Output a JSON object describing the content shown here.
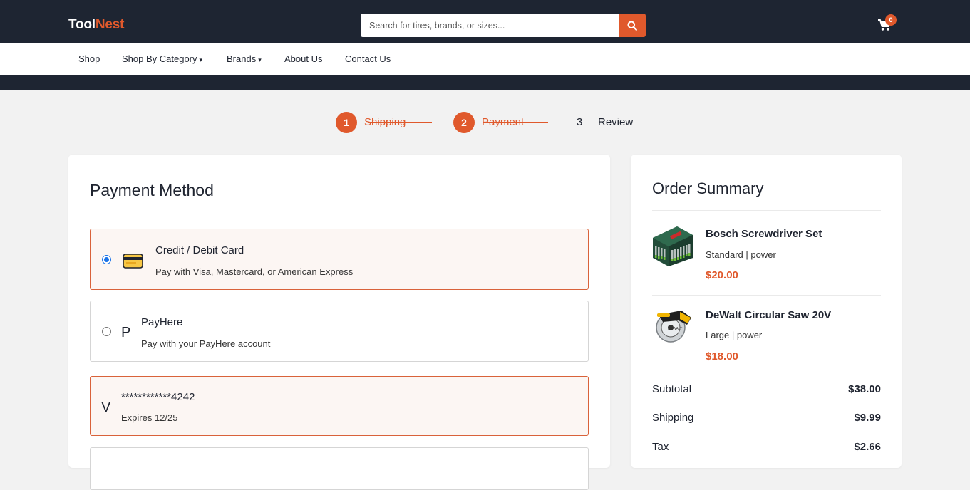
{
  "header": {
    "logo_part1": "Tool",
    "logo_part2": "Nest",
    "search_placeholder": "Search for tires, brands, or sizes...",
    "cart_count": "0",
    "accent_color": "#e0592c",
    "dark_color": "#1e2532"
  },
  "nav": {
    "items": [
      {
        "label": "Shop"
      },
      {
        "label": "Shop By Category",
        "caret": "▾"
      },
      {
        "label": "Brands",
        "caret": "▾"
      },
      {
        "label": "About Us"
      },
      {
        "label": "Contact Us"
      }
    ]
  },
  "stepper": {
    "steps": [
      {
        "num": "1",
        "label": "Shipping",
        "state": "complete"
      },
      {
        "num": "2",
        "label": "Payment",
        "state": "active"
      },
      {
        "num": "3",
        "label": "Review",
        "state": "pending"
      }
    ]
  },
  "payment": {
    "title": "Payment Method",
    "options": [
      {
        "title": "Credit / Debit Card",
        "subtitle": "Pay with Visa, Mastercard, or American Express",
        "icon": "credit-card-icon",
        "selected": true
      },
      {
        "letter": "P",
        "title": "PayHere",
        "subtitle": "Pay with your PayHere account",
        "selected": false
      }
    ],
    "saved_card": {
      "letter": "V",
      "number": "************4242",
      "expiry": "Expires 12/25"
    }
  },
  "summary": {
    "title": "Order Summary",
    "items": [
      {
        "name": "Bosch Screwdriver Set",
        "meta": "Standard | power",
        "price": "$20.00",
        "image": "screwdriver-set-image"
      },
      {
        "name": "DeWalt Circular Saw 20V",
        "meta": "Large | power",
        "price": "$18.00",
        "image": "circular-saw-image"
      }
    ],
    "rows": [
      {
        "label": "Subtotal",
        "value": "$38.00"
      },
      {
        "label": "Shipping",
        "value": "$9.99"
      },
      {
        "label": "Tax",
        "value": "$2.66"
      }
    ]
  }
}
